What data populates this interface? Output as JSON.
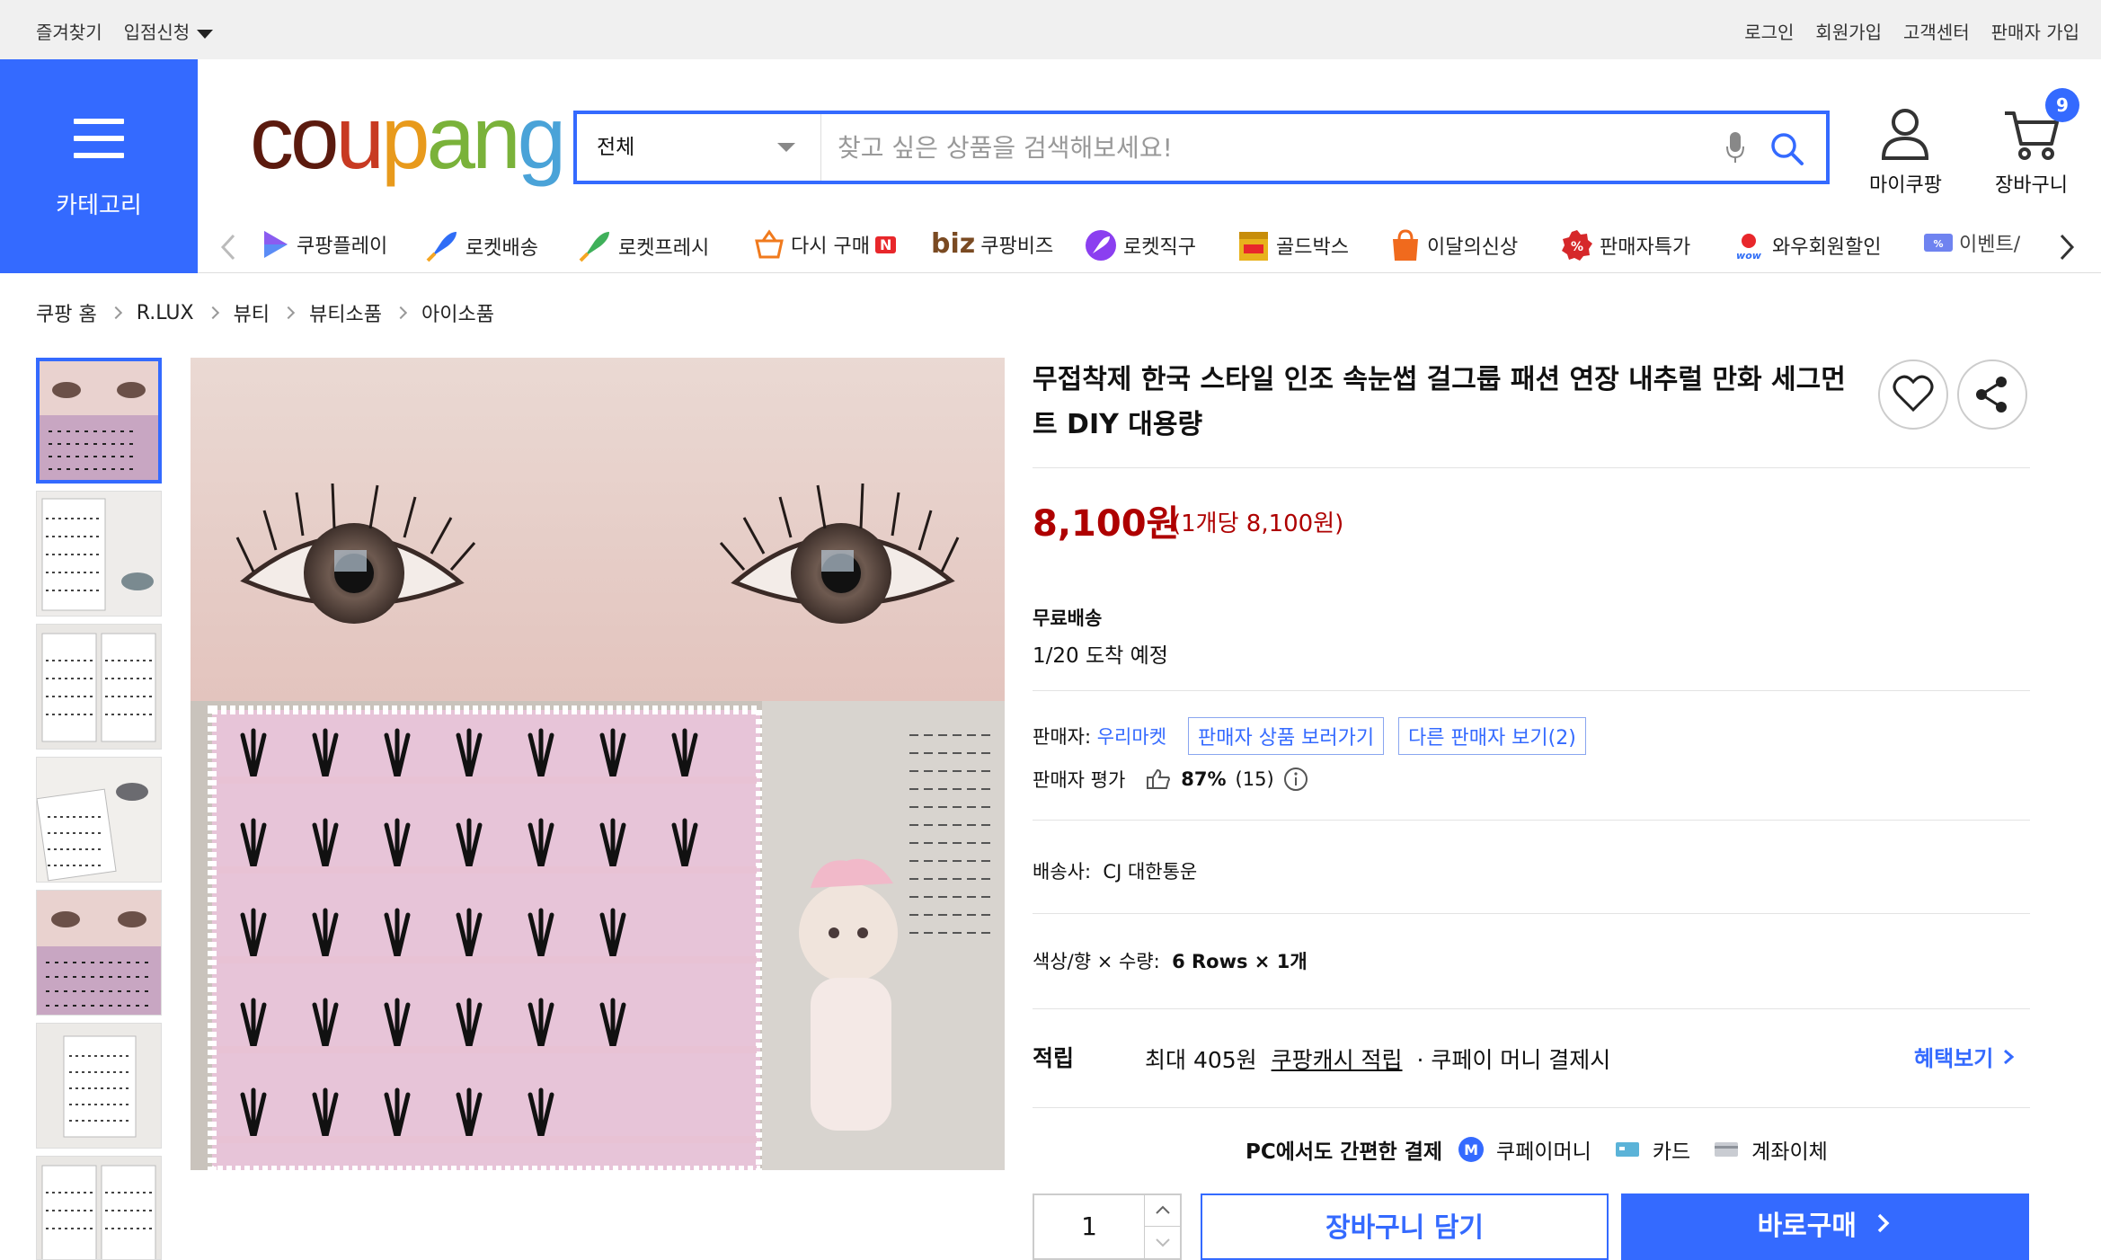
{
  "topbar": {
    "bookmark": "즐겨찾기",
    "partner": "입점신청",
    "links": [
      "로그인",
      "회원가입",
      "고객센터",
      "판매자 가입"
    ]
  },
  "header": {
    "category_label": "카테고리",
    "logo": {
      "c": "c",
      "o": "o",
      "u": "u",
      "p": "p",
      "a": "a",
      "n": "n",
      "g": "g"
    },
    "search_category": "전체",
    "search_placeholder": "찾고 싶은 상품을 검색해보세요!",
    "mycoupang": "마이쿠팡",
    "cart": "장바구니",
    "cart_count": "9"
  },
  "service_nav": [
    {
      "label": "쿠팡플레이",
      "icon": "play-icon",
      "color": "#5b5bd6"
    },
    {
      "label": "로켓배송",
      "icon": "rocket-icon",
      "color": "#2f6df6"
    },
    {
      "label": "로켓프레시",
      "icon": "rocket-fresh-icon",
      "color": "#3fb05a"
    },
    {
      "label": "다시 구매",
      "icon": "basket-icon",
      "color": "#f07a1d",
      "badge": "N"
    },
    {
      "label": "쿠팡비즈",
      "icon": "biz-icon",
      "color": "#7a4a22",
      "prefix": "biz"
    },
    {
      "label": "로켓직구",
      "icon": "rocket-global-icon",
      "color": "#8b3ff0"
    },
    {
      "label": "골드박스",
      "icon": "goldbox-icon",
      "color": "#e8b21c"
    },
    {
      "label": "이달의신상",
      "icon": "new-icon",
      "color": "#f06a1d"
    },
    {
      "label": "판매자특가",
      "icon": "discount-icon",
      "color": "#e03a2a"
    },
    {
      "label": "와우회원할인",
      "icon": "wow-icon",
      "color": "#2f6df6"
    },
    {
      "label": "이벤트/",
      "icon": "event-icon",
      "color": "#6f83f0"
    }
  ],
  "breadcrumb": [
    "쿠팡 홈",
    "R.LUX",
    "뷰티",
    "뷰티소품",
    "아이소품"
  ],
  "product": {
    "title": "무접착제 한국 스타일 인조 속눈썹 걸그룹 패션 연장 내추럴 만화 세그먼트 DIY 대용량",
    "price": "8,100원",
    "unit_price": "(1개당 8,100원)",
    "shipping_label": "무료배송",
    "arrival": "1/20 도착 예정",
    "seller_prefix": "판매자:",
    "seller_name": "우리마켓",
    "seller_products_button": "판매자 상품 보러가기",
    "other_sellers_button": "다른 판매자 보기(2)",
    "seller_rating_label": "판매자 평가",
    "seller_rating_value": "87%",
    "seller_rating_count": "(15)",
    "carrier_label": "배송사:",
    "carrier": "CJ 대한통운",
    "option_label": "색상/향 × 수량:",
    "option_value": "6 Rows × 1개",
    "reward_label": "적립",
    "reward_amount": "최대 405원",
    "reward_link": "쿠팡캐시 적립",
    "reward_condition": "· 쿠페이 머니 결제시",
    "benefit_link": "혜택보기",
    "payment_title": "PC에서도 간편한 결제",
    "payment_methods": [
      "쿠페이머니",
      "카드",
      "계좌이체"
    ],
    "payment_money_badge": "M",
    "quantity": "1",
    "add_to_cart": "장바구니 담기",
    "buy_now": "바로구매"
  },
  "colors": {
    "accent": "#346aff",
    "price": "#ae0000"
  }
}
